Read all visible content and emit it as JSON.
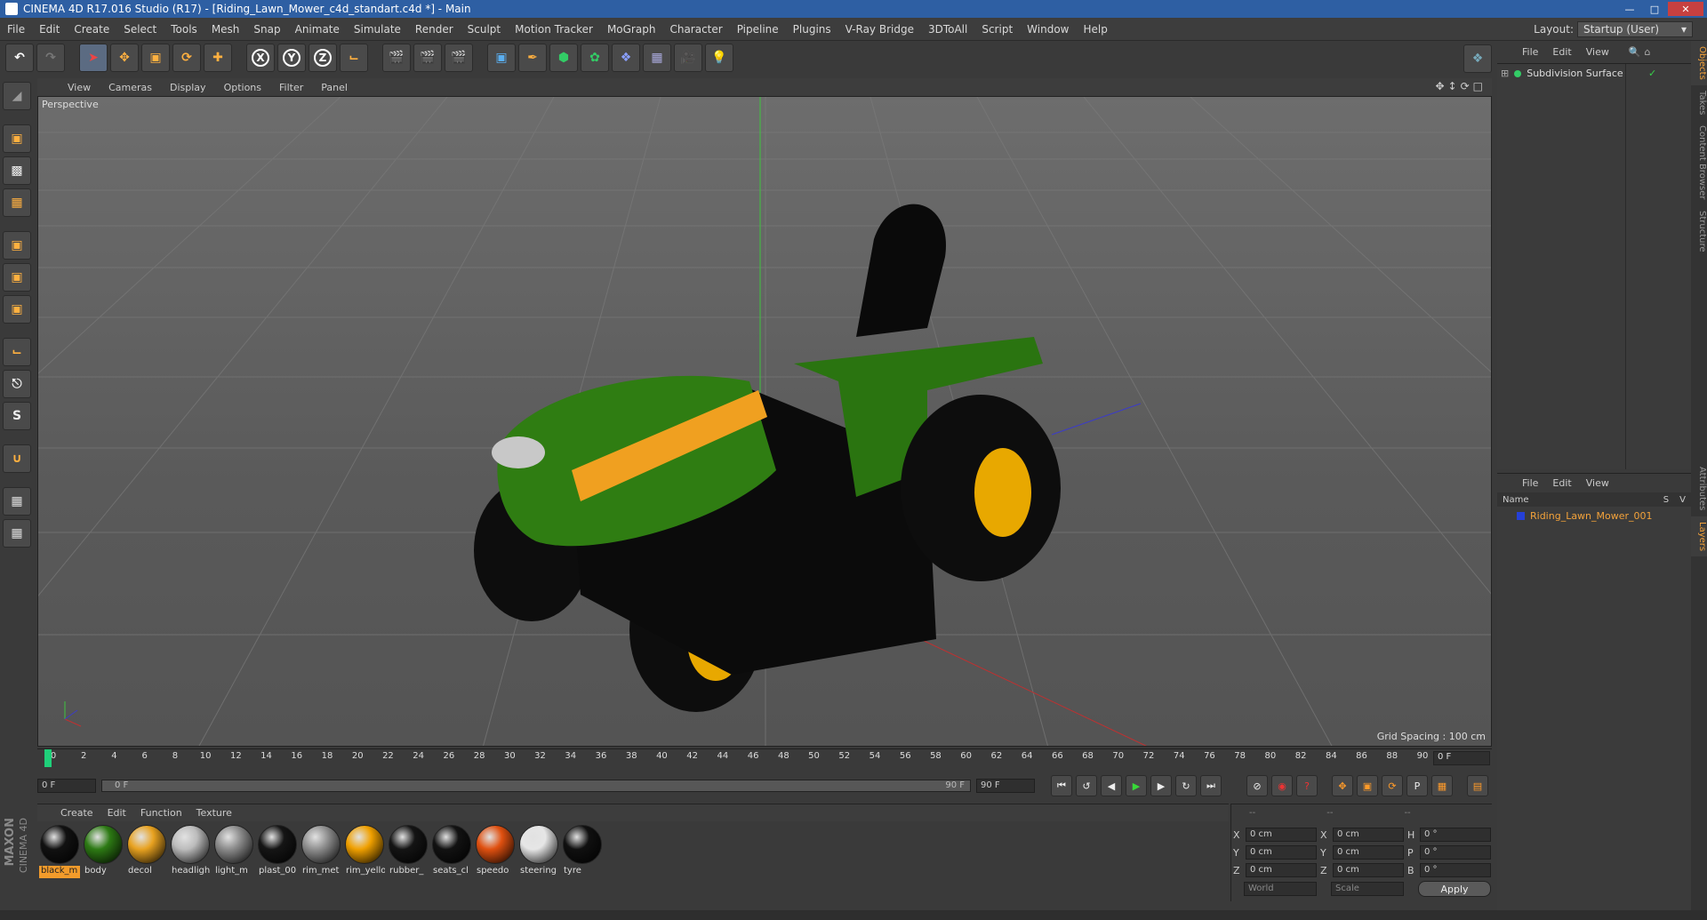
{
  "window": {
    "title": "CINEMA 4D R17.016 Studio (R17) - [Riding_Lawn_Mower_c4d_standart.c4d *] - Main"
  },
  "menu": [
    "File",
    "Edit",
    "Create",
    "Select",
    "Tools",
    "Mesh",
    "Snap",
    "Animate",
    "Simulate",
    "Render",
    "Sculpt",
    "Motion Tracker",
    "MoGraph",
    "Character",
    "Pipeline",
    "Plugins",
    "V-Ray Bridge",
    "3DToAll",
    "Script",
    "Window",
    "Help"
  ],
  "layout": {
    "label": "Layout:",
    "value": "Startup (User)"
  },
  "toolbar": {
    "x": "X",
    "y": "Y",
    "z": "Z"
  },
  "viewport": {
    "menu": [
      "View",
      "Cameras",
      "Display",
      "Options",
      "Filter",
      "Panel"
    ],
    "label": "Perspective",
    "grid_spacing": "Grid Spacing : 100 cm"
  },
  "timeline": {
    "ticks": [
      "0",
      "2",
      "4",
      "6",
      "8",
      "10",
      "12",
      "14",
      "16",
      "18",
      "20",
      "22",
      "24",
      "26",
      "28",
      "30",
      "32",
      "34",
      "36",
      "38",
      "40",
      "42",
      "44",
      "46",
      "48",
      "50",
      "52",
      "54",
      "56",
      "58",
      "60",
      "62",
      "64",
      "66",
      "68",
      "70",
      "72",
      "74",
      "76",
      "78",
      "80",
      "82",
      "84",
      "86",
      "88",
      "90"
    ],
    "current_frame": "0 F"
  },
  "transport": {
    "start": "0 F",
    "range_start": "0 F",
    "range_end": "90 F",
    "end": "90 F"
  },
  "material_menu": [
    "Create",
    "Edit",
    "Function",
    "Texture"
  ],
  "materials": [
    {
      "name": "black_m",
      "color": "#111111",
      "selected": true
    },
    {
      "name": "body",
      "color": "#2d7a14"
    },
    {
      "name": "decol",
      "color": "#e8a220"
    },
    {
      "name": "headligh",
      "color": "#bcbcbc"
    },
    {
      "name": "light_m",
      "color": "#8c8c8c"
    },
    {
      "name": "plast_00",
      "color": "#151515"
    },
    {
      "name": "rim_met",
      "color": "#909090"
    },
    {
      "name": "rim_yello",
      "color": "#f0a000"
    },
    {
      "name": "rubber_",
      "color": "#141414"
    },
    {
      "name": "seats_cl",
      "color": "#121212"
    },
    {
      "name": "speedo",
      "color": "#e05010"
    },
    {
      "name": "steering",
      "color": "#e6e6e6"
    },
    {
      "name": "tyre",
      "color": "#101010"
    }
  ],
  "coords": {
    "dashes": [
      "--",
      "--",
      "--"
    ],
    "rows": [
      {
        "a": "X",
        "v1": "0 cm",
        "b": "X",
        "v2": "0 cm",
        "c": "H",
        "v3": "0 °"
      },
      {
        "a": "Y",
        "v1": "0 cm",
        "b": "Y",
        "v2": "0 cm",
        "c": "P",
        "v3": "0 °"
      },
      {
        "a": "Z",
        "v1": "0 cm",
        "b": "Z",
        "v2": "0 cm",
        "c": "B",
        "v3": "0 °"
      }
    ],
    "mode1": "World",
    "mode2": "Scale",
    "apply": "Apply"
  },
  "objects": {
    "menu": [
      "File",
      "Edit",
      "View"
    ],
    "items": [
      {
        "name": "Subdivision Surface"
      }
    ]
  },
  "layers": {
    "menu": [
      "File",
      "Edit",
      "View"
    ],
    "header_name": "Name",
    "header_s": "S",
    "header_v": "V",
    "items": [
      {
        "name": "Riding_Lawn_Mower_001"
      }
    ]
  },
  "side_tabs": [
    "Objects",
    "Takes",
    "Content Browser",
    "Structure",
    "Attributes",
    "Layers"
  ],
  "brand": {
    "line1": "MAXON",
    "line2": "CINEMA 4D"
  }
}
